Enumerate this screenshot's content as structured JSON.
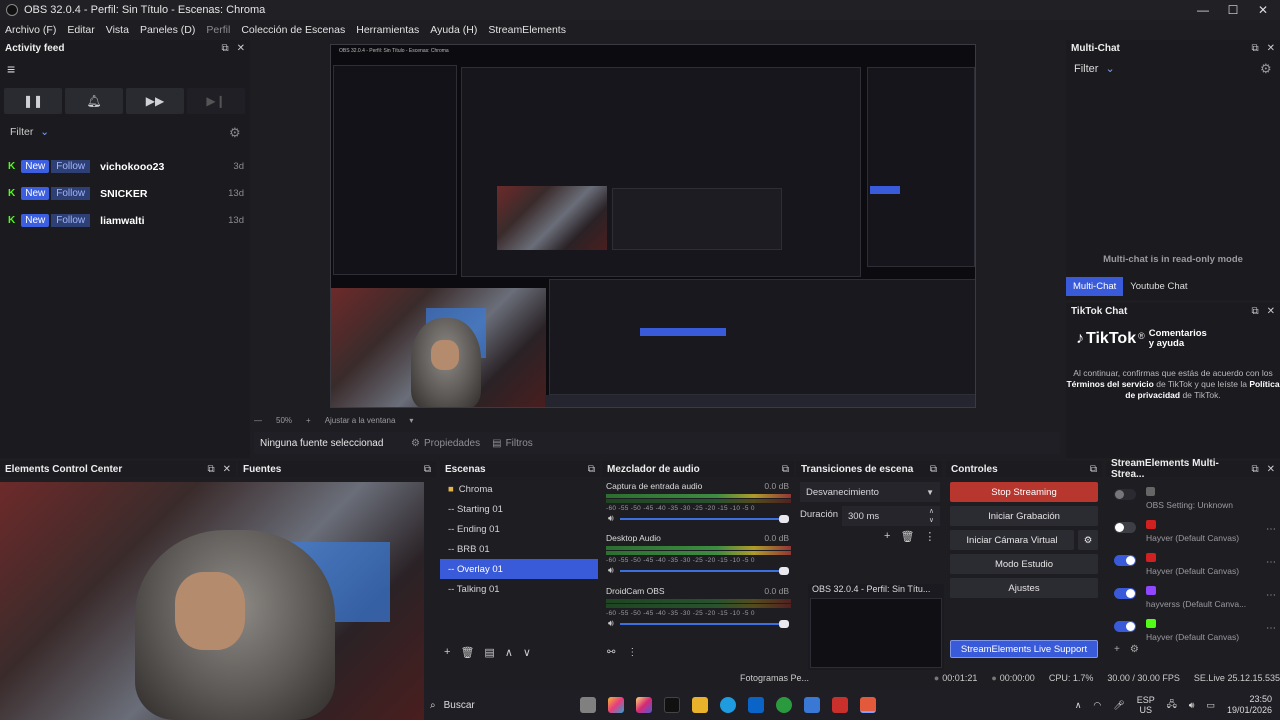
{
  "window": {
    "title": "OBS 32.0.4 - Perfil: Sin Título - Escenas: Chroma",
    "controls": {
      "minimize": "—",
      "maximize": "☐",
      "close": "✕"
    }
  },
  "menu": [
    "Archivo (F)",
    "Editar",
    "Vista",
    "Paneles (D)",
    "Perfil",
    "Colección de Escenas",
    "Herramientas",
    "Ayuda (H)",
    "StreamElements"
  ],
  "activity_feed": {
    "title": "Activity feed",
    "filter_label": "Filter",
    "items": [
      {
        "badge_new": "New",
        "badge_type": "Follow",
        "name": "vichokooo23",
        "age": "3d"
      },
      {
        "badge_new": "New",
        "badge_type": "Follow",
        "name": "SNICKER",
        "age": "13d"
      },
      {
        "badge_new": "New",
        "badge_type": "Follow",
        "name": "liamwalti",
        "age": "13d"
      }
    ]
  },
  "multichat": {
    "title": "Multi-Chat",
    "filter_label": "Filter",
    "readonly_text": "Multi-chat is in read-only mode",
    "tabs": [
      "Multi-Chat",
      "Youtube Chat"
    ]
  },
  "tiktok": {
    "title": "TikTok Chat",
    "logo_text": "TikTok",
    "tagline": "Comentarios y ayuda",
    "consent_1": "Al continuar, confirmas que estás de acuerdo con los",
    "consent_link_1": "Términos del servicio",
    "consent_2": "de TikTok y que leíste la",
    "consent_link_2": "Política de privacidad",
    "consent_3": "de TikTok."
  },
  "preview_bar": {
    "zoom": "50%",
    "fit": "Ajustar a la ventana",
    "mini_title": "OBS 32.0.4 - Perfil: Sin Título - Escenas: Chroma"
  },
  "source_bar": {
    "selection": "Ninguna fuente seleccionad",
    "properties": "Propiedades",
    "filters": "Filtros"
  },
  "docks": {
    "elements": "Elements Control Center",
    "sources": "Fuentes",
    "scenes": "Escenas",
    "mixer": "Mezclador de audio",
    "transitions": "Transiciones de escena",
    "controls": "Controles",
    "se_multistream": "StreamElements Multi-Strea..."
  },
  "scenes": {
    "folder": "Chroma",
    "items": [
      "-- Starting 01",
      "-- Ending 01",
      "-- BRB 01",
      "-- Overlay 01",
      "-- Talking 01"
    ],
    "selected_index": 3
  },
  "mixer": {
    "channels": [
      {
        "name": "Captura de entrada audio",
        "db": "0.0 dB",
        "level": 0.93
      },
      {
        "name": "Desktop Audio",
        "db": "0.0 dB",
        "level": 0.95
      },
      {
        "name": "DroidCam OBS",
        "db": "0.0 dB",
        "level": 0.0
      }
    ],
    "scale": "-60 -55 -50 -45 -40 -35 -30 -25 -20 -15 -10 -5 0"
  },
  "transitions": {
    "type": "Desvanecimiento",
    "duration_label": "Duración",
    "duration_value": "300 ms",
    "window_preview": "OBS 32.0.4 - Perfil: Sin Títu..."
  },
  "controls": {
    "stop_streaming": "Stop Streaming",
    "recording": "Iniciar Grabación",
    "virtual_cam": "Iniciar Cámara Virtual",
    "studio_mode": "Modo Estudio",
    "settings": "Ajustes",
    "support": "StreamElements Live Support"
  },
  "multistream": [
    {
      "on": false,
      "label": "OBS Setting: Unknown",
      "color": "#777777"
    },
    {
      "on": false,
      "label": "Hayver (Default Canvas)",
      "color": "#d02020"
    },
    {
      "on": true,
      "label": "Hayver (Default Canvas)",
      "color": "#d02020"
    },
    {
      "on": true,
      "label": "hayverss (Default Canva...",
      "color": "#9146ff"
    },
    {
      "on": true,
      "label": "Hayver (Default Canvas)",
      "color": "#53fc18"
    }
  ],
  "status": {
    "frames": "Fotogramas Pe...",
    "live_time": "00:01:21",
    "rec_time": "00:00:00",
    "cpu": "CPU: 1.7%",
    "fps": "30.00 / 30.00 FPS",
    "version": "SE.Live 25.12.15.535"
  },
  "taskbar": {
    "search": "Buscar",
    "lang": "ESP",
    "region": "US",
    "time": "23:50",
    "date": "19/01/2026"
  }
}
